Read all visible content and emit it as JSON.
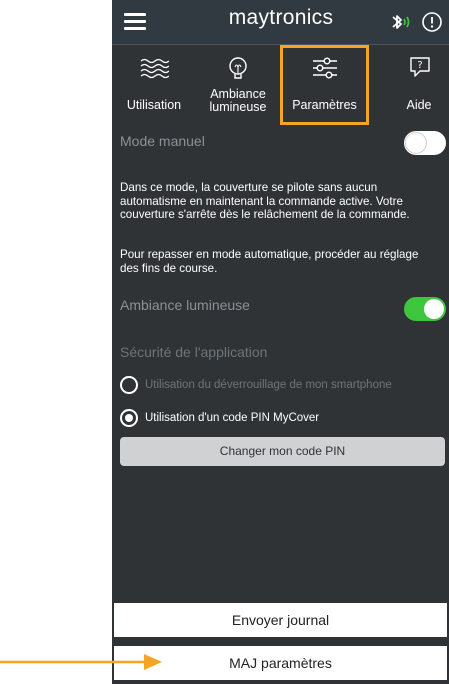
{
  "header": {
    "logo_text": "maytronics",
    "menu_icon": "hamburger-menu-icon",
    "bluetooth_icon": "bluetooth-icon",
    "info_icon": "info-icon"
  },
  "tabs": [
    {
      "label": "Utilisation",
      "icon": "waves-icon"
    },
    {
      "label_line1": "Ambiance",
      "label_line2": "lumineuse",
      "icon": "lightbulb-icon"
    },
    {
      "label": "Paramètres",
      "icon": "sliders-icon",
      "active": true
    },
    {
      "label": "Aide",
      "icon": "help-chat-icon"
    }
  ],
  "settings": {
    "manual_mode_label": "Mode manuel",
    "manual_mode_on": false,
    "manual_desc": "Dans ce mode, la couverture se pilote sans aucun automatisme en maintenant la commande active. Votre couverture s'arrête dès le relâchement de la commande.",
    "auto_desc": "Pour repasser en mode automatique, procéder au réglage des fins de course.",
    "ambiance_label": "Ambiance lumineuse",
    "ambiance_on": true,
    "security_title": "Sécurité de l'application",
    "option_smartphone": "Utilisation du déverrouillage de mon smartphone",
    "option_pin": "Utilisation d'un code PIN MyCover",
    "selected_option": "pin",
    "change_pin_button": "Changer mon code PIN"
  },
  "footer": {
    "send_log_button": "Envoyer journal",
    "update_params_button": "MAJ paramètres"
  },
  "colors": {
    "background": "#2f3336",
    "accent_orange": "#f4a623",
    "toggle_on": "#3ec63e",
    "toggle_off": "#ffffff"
  }
}
